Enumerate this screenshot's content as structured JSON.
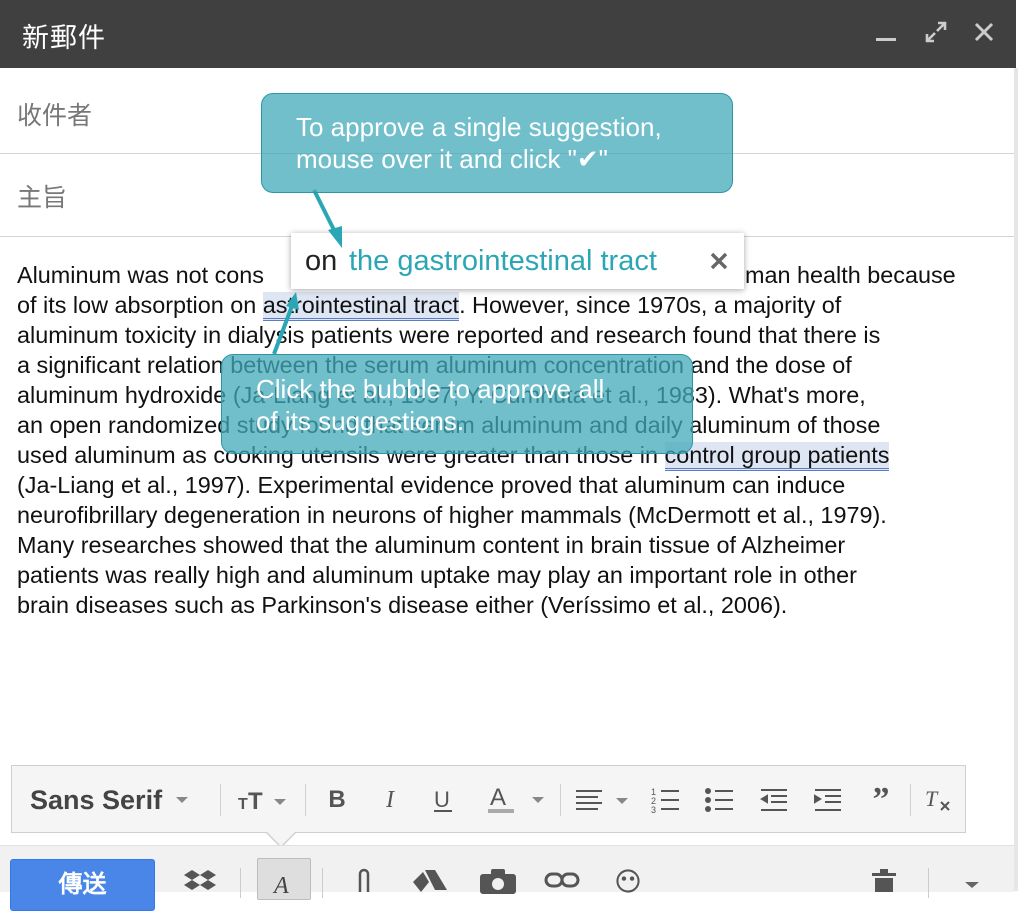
{
  "window": {
    "title": "新郵件",
    "minimize_icon": "minimize-icon",
    "expand_icon": "expand-icon",
    "close_icon": "close-icon"
  },
  "fields": {
    "to_label": "收件者",
    "subject_label": "主旨"
  },
  "body": {
    "lines": [
      {
        "pre": "Aluminum was not cons",
        "hl": "",
        "post": "man health because"
      },
      {
        "pre": "of its low absorption on ",
        "hl": "astrointestinal tract",
        "post": ". However, since 1970s, a majority of"
      },
      {
        "pre": "aluminum toxicity in dialysis patients were reported and research found that there is",
        "hl": "",
        "post": ""
      },
      {
        "pre": "a significant relation between the serum aluminum concentration and the dose of",
        "hl": "",
        "post": ""
      },
      {
        "pre": "aluminum hydroxide (Ja-Liang et al., 1997; Y. Cumhuta et al., 1983). What's more,",
        "hl": "",
        "post": ""
      },
      {
        "pre": "an open randomized study found that serum aluminum and daily aluminum of those",
        "hl": "",
        "post": ""
      },
      {
        "pre": "used aluminum as cooking utensils were greater than those in ",
        "hl": "control group patients",
        "post": ""
      },
      {
        "pre": "(Ja-Liang et al., 1997). Experimental evidence proved that aluminum can induce",
        "hl": "",
        "post": ""
      },
      {
        "pre": "neurofibrillary degeneration in neurons of higher mammals (McDermott et al., 1979).",
        "hl": "",
        "post": ""
      },
      {
        "pre": "Many researches showed that the aluminum content in brain tissue of Alzheimer",
        "hl": "",
        "post": ""
      },
      {
        "pre": "patients was really high and aluminum uptake may play an important role in other",
        "hl": "",
        "post": ""
      },
      {
        "pre": "brain diseases such as Parkinson's disease either (Veríssimo et al., 2006).",
        "hl": "",
        "post": ""
      }
    ]
  },
  "suggestion_popup": {
    "prefix": "on",
    "suggestion": "the gastrointestinal tract",
    "dismiss_icon": "close-icon"
  },
  "tooltips": {
    "approve_single_line1": "To approve a single suggestion,",
    "approve_single_line2": "mouse over it and click \"✔\"",
    "approve_all_line1": "Click the bubble to approve all",
    "approve_all_line2": "of its suggestions."
  },
  "toolbar": {
    "font": "Sans Serif",
    "icons": [
      "font-size-icon",
      "bold-icon",
      "italic-icon",
      "underline-icon",
      "text-color-icon",
      "align-icon",
      "numbered-list-icon",
      "bulleted-list-icon",
      "indent-less-icon",
      "indent-more-icon",
      "quote-icon",
      "remove-formatting-icon"
    ]
  },
  "bottom": {
    "send_label": "傳送",
    "icons": [
      "dropbox-icon",
      "formatting-icon",
      "attach-icon",
      "drive-icon",
      "photo-icon",
      "link-icon",
      "emoji-icon",
      "trash-icon",
      "more-options-icon"
    ]
  },
  "colors": {
    "title_bar": "#404040",
    "suggestion_accent": "#2ba6b5",
    "tooltip_bg": "#41aab9",
    "send_button": "#4a86e8",
    "highlight": "#dfe6f3"
  }
}
